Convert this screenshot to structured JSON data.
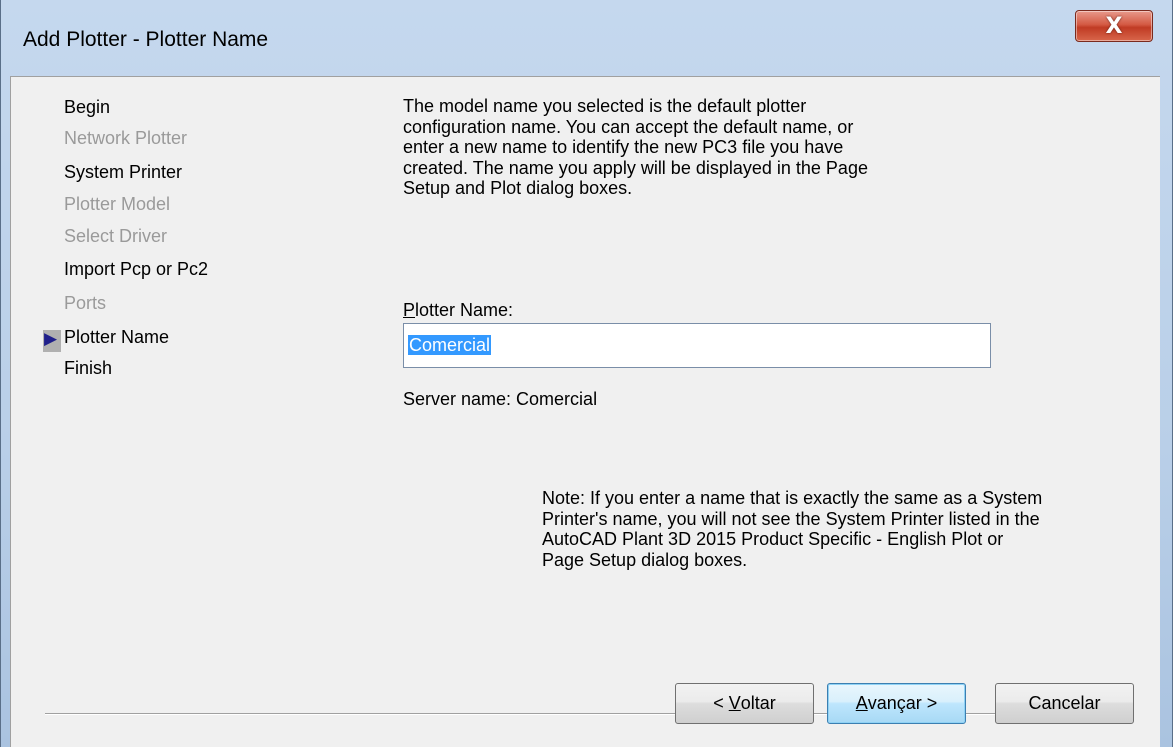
{
  "window": {
    "title": "Add Plotter - Plotter Name",
    "close_glyph": "X"
  },
  "steps": [
    {
      "label": "Begin",
      "enabled": true
    },
    {
      "label": "Network Plotter",
      "enabled": false
    },
    {
      "label": "System Printer",
      "enabled": true
    },
    {
      "label": "Plotter Model",
      "enabled": false
    },
    {
      "label": "Select Driver",
      "enabled": false
    },
    {
      "label": "Import Pcp or Pc2",
      "enabled": true
    },
    {
      "label": "Ports",
      "enabled": false
    },
    {
      "label": "Plotter Name",
      "enabled": true,
      "current": true
    },
    {
      "label": "Finish",
      "enabled": true
    }
  ],
  "current_step_marker": "▶",
  "description": {
    "lines": [
      "The model name you selected is the default plotter",
      "configuration name. You can accept the default name, or",
      "enter a new name to identify the new PC3 file you have",
      "created. The name you apply will be displayed in the Page",
      "Setup and Plot dialog boxes."
    ]
  },
  "plotter_name": {
    "label": "Plotter Name:",
    "mnemonic": "P",
    "value": "Comercial"
  },
  "server_name": "Server name: Comercial",
  "note": {
    "lines": [
      "Note: If you enter a name that is exactly the same as a System",
      "Printer's name, you will not see the System Printer listed in the",
      "AutoCAD Plant 3D 2015 Product Specific - English Plot or",
      "Page Setup dialog boxes."
    ]
  },
  "buttons": {
    "back": {
      "prefix": "< ",
      "mnemonic": "V",
      "rest": "oltar"
    },
    "next": {
      "mnemonic": "A",
      "rest": "vançar >"
    },
    "cancel": {
      "label": "Cancelar"
    }
  },
  "colors": {
    "selection": "#3399ff",
    "disabled_text": "#9a9a9a",
    "close_button": "#c03b24"
  }
}
